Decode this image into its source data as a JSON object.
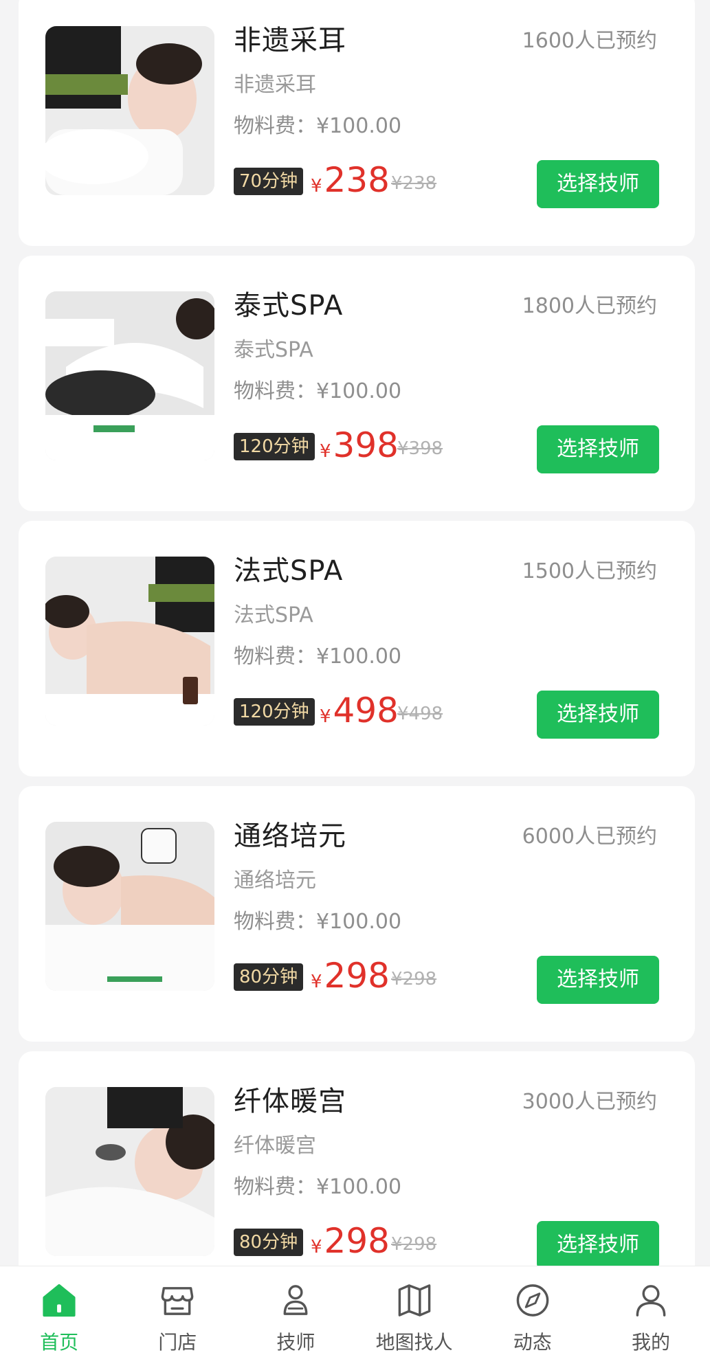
{
  "services": [
    {
      "title": "非遗采耳",
      "booked": "1600人已预约",
      "subtitle": "非遗采耳",
      "material": "物料费：¥100.00",
      "duration": "70分钟",
      "price_symbol": "¥",
      "price": "238",
      "old_price": "¥238",
      "button": "选择技师"
    },
    {
      "title": "泰式SPA",
      "booked": "1800人已预约",
      "subtitle": "泰式SPA",
      "material": "物料费：¥100.00",
      "duration": "120分钟",
      "price_symbol": "¥",
      "price": "398",
      "old_price": "¥398",
      "button": "选择技师"
    },
    {
      "title": "法式SPA",
      "booked": "1500人已预约",
      "subtitle": "法式SPA",
      "material": "物料费：¥100.00",
      "duration": "120分钟",
      "price_symbol": "¥",
      "price": "498",
      "old_price": "¥498",
      "button": "选择技师"
    },
    {
      "title": "通络培元",
      "booked": "6000人已预约",
      "subtitle": "通络培元",
      "material": "物料费：¥100.00",
      "duration": "80分钟",
      "price_symbol": "¥",
      "price": "298",
      "old_price": "¥298",
      "button": "选择技师"
    },
    {
      "title": "纤体暖宫",
      "booked": "3000人已预约",
      "subtitle": "纤体暖宫",
      "material": "物料费：¥100.00",
      "duration": "80分钟",
      "price_symbol": "¥",
      "price": "298",
      "old_price": "¥298",
      "button": "选择技师"
    }
  ],
  "tabbar": {
    "active": 0,
    "items": [
      {
        "label": "首页",
        "icon": "home-icon"
      },
      {
        "label": "门店",
        "icon": "store-icon"
      },
      {
        "label": "技师",
        "icon": "technician-icon"
      },
      {
        "label": "地图找人",
        "icon": "map-icon"
      },
      {
        "label": "动态",
        "icon": "compass-icon"
      },
      {
        "label": "我的",
        "icon": "profile-icon"
      }
    ]
  },
  "colors": {
    "accent": "#1fbe5a",
    "price": "#e0312a",
    "badge_bg": "#2b2b2b",
    "badge_text": "#f1d9a5"
  }
}
